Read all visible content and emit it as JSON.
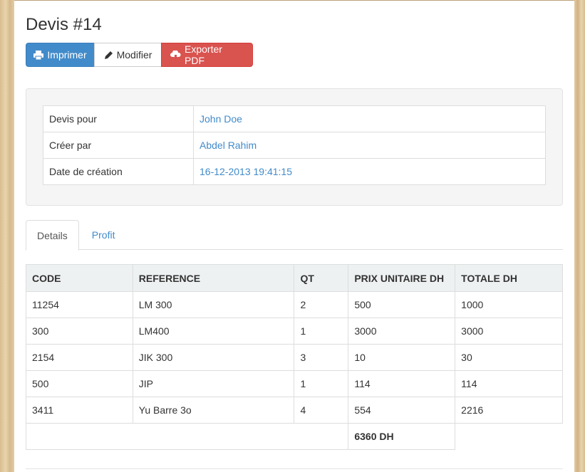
{
  "page": {
    "title": "Devis #14"
  },
  "toolbar": {
    "print_label": "Imprimer",
    "edit_label": "Modifier",
    "pdf_label": "Exporter PDF",
    "print_icon": "printer-icon",
    "edit_icon": "pencil-icon",
    "pdf_icon": "cloud-download-icon"
  },
  "info": {
    "rows": [
      {
        "label": "Devis pour",
        "value": "John Doe"
      },
      {
        "label": "Créer par",
        "value": "Abdel Rahim"
      },
      {
        "label": "Date de création",
        "value": "16-12-2013 19:41:15"
      }
    ]
  },
  "tabs": [
    {
      "label": "Details",
      "active": true
    },
    {
      "label": "Profit",
      "active": false
    }
  ],
  "items": {
    "headers": [
      "CODE",
      "REFERENCE",
      "QT",
      "PRIX UNITAIRE DH",
      "TOTALE DH"
    ],
    "rows": [
      [
        "11254",
        "LM 300",
        "2",
        "500",
        "1000"
      ],
      [
        "300",
        "LM400",
        "1",
        "3000",
        "3000"
      ],
      [
        "2154",
        "JIK 300",
        "3",
        "10",
        "30"
      ],
      [
        "500",
        "JIP",
        "1",
        "114",
        "114"
      ],
      [
        "3411",
        "Yu Barre 3o",
        "4",
        "554",
        "2216"
      ]
    ],
    "total": "6360 DH"
  },
  "colors": {
    "primary": "#428bca",
    "danger": "#d9534f",
    "link": "#428bca"
  }
}
